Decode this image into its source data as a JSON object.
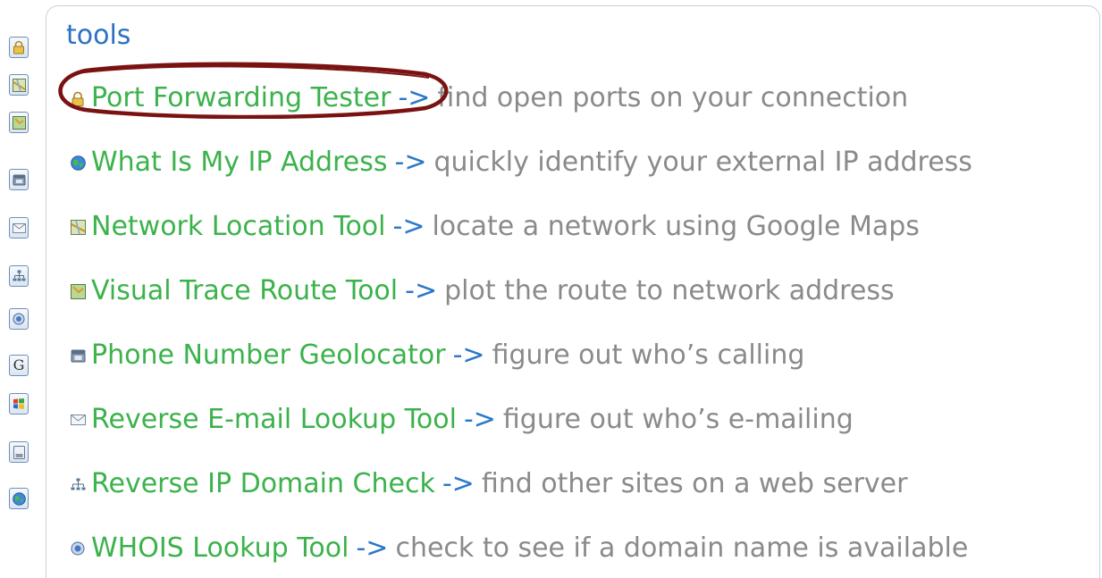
{
  "sidebar": {
    "buttons": [
      {
        "icon": "lock-icon"
      },
      {
        "icon": "map-icon"
      },
      {
        "icon": "trace-route-icon"
      },
      {
        "icon": "phone-icon"
      },
      {
        "icon": "envelope-icon"
      },
      {
        "icon": "network-icon"
      },
      {
        "icon": "whois-icon"
      },
      {
        "icon": "google-icon",
        "label": "G"
      },
      {
        "icon": "windows-icon"
      },
      {
        "icon": "document-icon"
      },
      {
        "icon": "globe-icon"
      }
    ]
  },
  "panel": {
    "title": "tools",
    "tools": [
      {
        "icon": "lock-icon",
        "name": "Port Forwarding Tester",
        "arrow": "->",
        "description": "find open ports on your connection"
      },
      {
        "icon": "globe-icon",
        "name": "What Is My IP Address",
        "arrow": "->",
        "description": "quickly identify your external IP address"
      },
      {
        "icon": "map-icon",
        "name": "Network Location Tool",
        "arrow": "->",
        "description": "locate a network using Google Maps"
      },
      {
        "icon": "trace-route-icon",
        "name": "Visual Trace Route Tool",
        "arrow": "->",
        "description": "plot the route to network address"
      },
      {
        "icon": "phone-icon",
        "name": "Phone Number Geolocator",
        "arrow": "->",
        "description": "figure out who’s calling"
      },
      {
        "icon": "envelope-icon",
        "name": "Reverse E-mail Lookup Tool",
        "arrow": "->",
        "description": "figure out who’s e-mailing"
      },
      {
        "icon": "network-icon",
        "name": "Reverse IP Domain Check",
        "arrow": "->",
        "description": "find other sites on a web server"
      },
      {
        "icon": "whois-icon",
        "name": "WHOIS Lookup Tool",
        "arrow": "->",
        "description": "check to see if a domain name is available"
      }
    ]
  },
  "colors": {
    "title": "#2b72c2",
    "link": "#3bb24b",
    "arrow": "#2b78c8",
    "description": "#8a8a8a",
    "highlight": "#7a1212"
  }
}
